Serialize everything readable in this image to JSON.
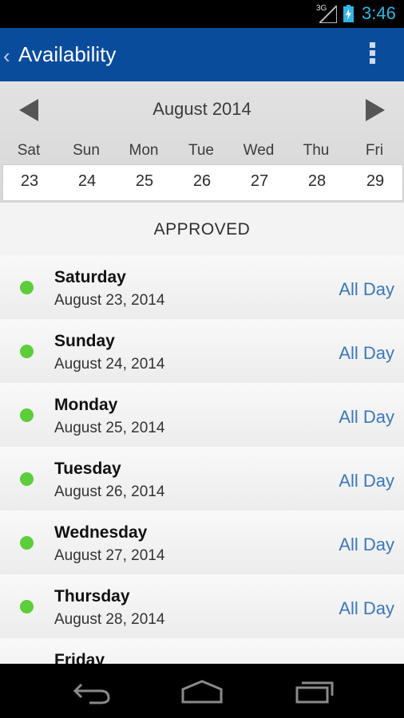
{
  "status_bar": {
    "network": "3G",
    "time": "3:46"
  },
  "action_bar": {
    "title": "Availability"
  },
  "calendar": {
    "month": "August 2014",
    "weekdays": [
      "Sat",
      "Sun",
      "Mon",
      "Tue",
      "Wed",
      "Thu",
      "Fri"
    ],
    "dates": [
      "23",
      "24",
      "25",
      "26",
      "27",
      "28",
      "29"
    ]
  },
  "section": {
    "title": "APPROVED"
  },
  "rows": [
    {
      "day": "Saturday",
      "date": "August 23, 2014",
      "range": "All Day"
    },
    {
      "day": "Sunday",
      "date": "August 24, 2014",
      "range": "All Day"
    },
    {
      "day": "Monday",
      "date": "August 25, 2014",
      "range": "All Day"
    },
    {
      "day": "Tuesday",
      "date": "August 26, 2014",
      "range": "All Day"
    },
    {
      "day": "Wednesday",
      "date": "August 27, 2014",
      "range": "All Day"
    },
    {
      "day": "Thursday",
      "date": "August 28, 2014",
      "range": "All Day"
    },
    {
      "day": "Friday",
      "date": "",
      "range": ""
    }
  ],
  "colors": {
    "action_bar": "#0a4c9c",
    "approved_dot": "#5ccd3b",
    "range_text": "#3b78b8"
  }
}
